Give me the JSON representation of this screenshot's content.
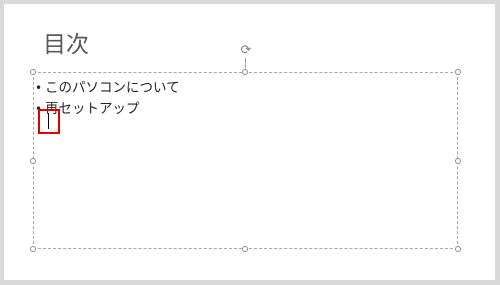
{
  "slide": {
    "title": "目次",
    "bullets": [
      {
        "marker": "•",
        "text": "このパソコンについて"
      },
      {
        "marker": "•",
        "text": "再セットアップ"
      }
    ]
  },
  "icons": {
    "rotate": "rotate-handle-icon"
  },
  "colors": {
    "highlight": "#e00000",
    "title_text": "#595959",
    "body_text": "#262626"
  }
}
